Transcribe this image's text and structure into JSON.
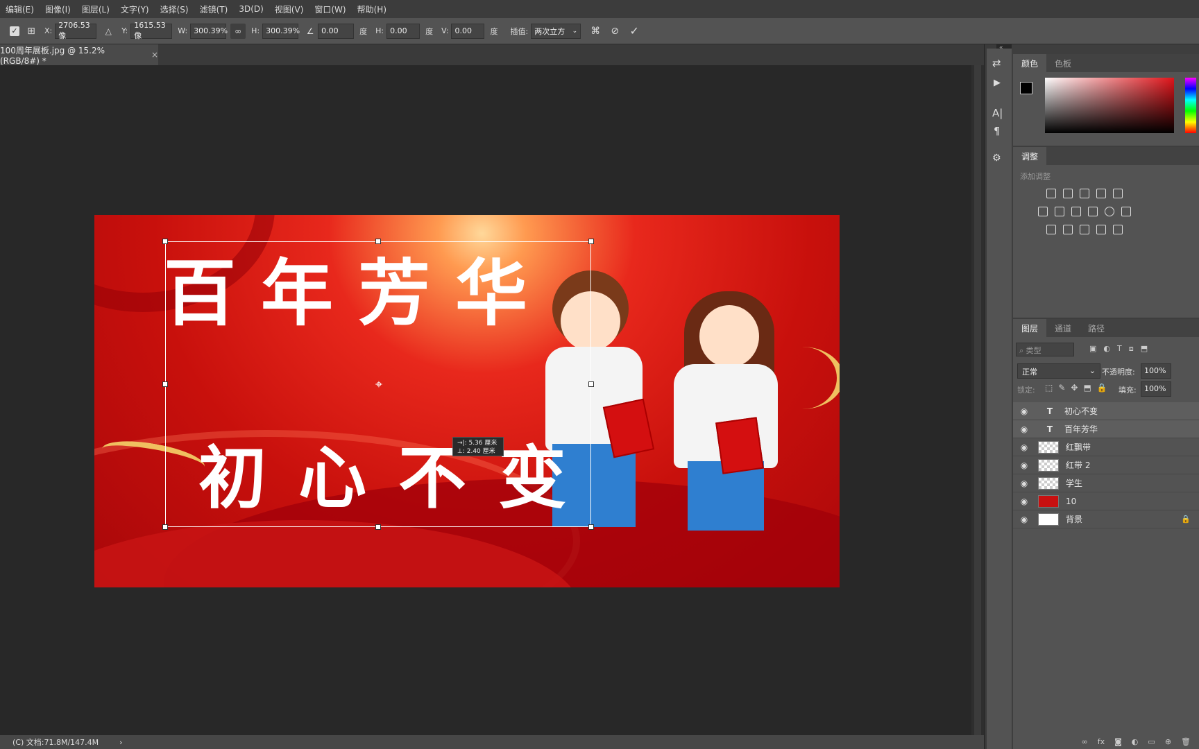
{
  "menu": [
    "编辑(E)",
    "图像(I)",
    "图层(L)",
    "文字(Y)",
    "选择(S)",
    "滤镜(T)",
    "3D(D)",
    "视图(V)",
    "窗口(W)",
    "帮助(H)"
  ],
  "options": {
    "x_label": "X:",
    "x_value": "2706.53 像",
    "y_label": "Y:",
    "y_value": "1615.53 像",
    "w_label": "W:",
    "w_value": "300.39%",
    "h_label": "H:",
    "h_value": "300.39%",
    "angle_value": "0.00",
    "deg": "度",
    "hskew_label": "H:",
    "hskew_value": "0.00",
    "vskew_label": "V:",
    "vskew_value": "0.00",
    "interp_label": "插值:",
    "interp_value": "两次立方"
  },
  "document": {
    "tab_title": "100周年展板.jpg @ 15.2%(RGB/8#) *",
    "close": "×",
    "status": "(C) 文档:71.8M/147.4M",
    "status_arrow": "›"
  },
  "artwork": {
    "line1": "百年芳华",
    "line2": "初心不变",
    "tooltip_line1": "→|: 5.36 厘米",
    "tooltip_line2": "⊥: 2.40 厘米"
  },
  "color_panel": {
    "tab1": "颜色",
    "tab2": "色板",
    "fg": "#000000",
    "bg": "#ffffff"
  },
  "adjust_panel": {
    "title": "调整",
    "subtitle": "添加调整"
  },
  "layers_panel": {
    "tabs": [
      "图层",
      "通道",
      "路径"
    ],
    "filter_placeholder": "类型",
    "blend_mode": "正常",
    "opacity_label": "不透明度:",
    "opacity_value": "100%",
    "lock_label": "锁定:",
    "fill_label": "填充:",
    "fill_value": "100%",
    "layers": [
      {
        "name": "初心不变",
        "kind": "text",
        "selected": true
      },
      {
        "name": "百年芳华",
        "kind": "text",
        "selected": true
      },
      {
        "name": "红飘带",
        "kind": "smart",
        "selected": false
      },
      {
        "name": "红带 2",
        "kind": "smart",
        "selected": false
      },
      {
        "name": "学生",
        "kind": "smart",
        "selected": false
      },
      {
        "name": "10",
        "kind": "smart-red",
        "selected": false
      },
      {
        "name": "背景",
        "kind": "background",
        "selected": false
      }
    ]
  },
  "colors": {
    "accent_red": "#d0120e",
    "panel": "#535353",
    "canvas_bg": "#282828"
  }
}
